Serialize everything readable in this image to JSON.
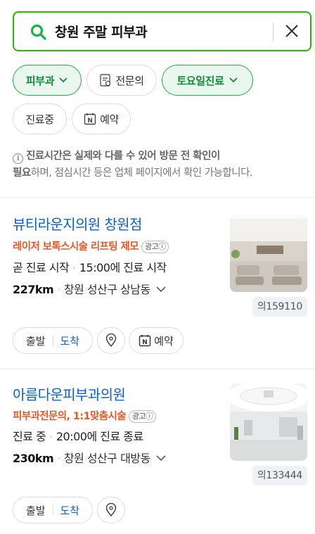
{
  "search": {
    "query": "창원 주말 피부과"
  },
  "filters": {
    "row1": [
      {
        "label": "피부과",
        "active": true,
        "dropdown": true
      },
      {
        "label": "전문의",
        "active": false,
        "icon": "specialist-doc-icon"
      },
      {
        "label": "토요일진료",
        "active": true,
        "dropdown": true
      }
    ],
    "row2": [
      {
        "label": "진료중",
        "active": false
      },
      {
        "label": "예약",
        "active": false,
        "icon": "naver-n-icon"
      }
    ]
  },
  "notice": {
    "bold_part1": "진료시간은 실제와 다를 수 있어 방문 전 확인이",
    "bold_part2": "필요",
    "rest": "하며, 점심시간 등은 업체 페이지에서 확인 가능합니다."
  },
  "results": [
    {
      "name": "뷰티라운지의원 창원점",
      "ad_text": "레이저 보톡스시술 리프팅 제모",
      "ad_badge": "광고ⓘ",
      "status": "곧 진료 시작",
      "hours": "15:00에 진료 시작",
      "distance": "227km",
      "address": "창원 성산구 상남동",
      "code": "의159110",
      "buttons": {
        "depart": "출발",
        "arrive": "도착",
        "reserve": "예약"
      }
    },
    {
      "name": "아름다운피부과의원",
      "ad_text": "피부과전문의, 1:1맞춤시술",
      "ad_badge": "광고ⓘ",
      "status": "진료 중",
      "hours": "20:00에 진료 종료",
      "distance": "230km",
      "address": "창원 성산구 대방동",
      "code": "의133444",
      "buttons": {
        "depart": "출발",
        "arrive": "도착"
      }
    }
  ],
  "colors": {
    "brand_green": "#2db400",
    "chip_active": "#118a39",
    "link_blue": "#0e60c4",
    "ad_orange": "#e05a2b"
  }
}
